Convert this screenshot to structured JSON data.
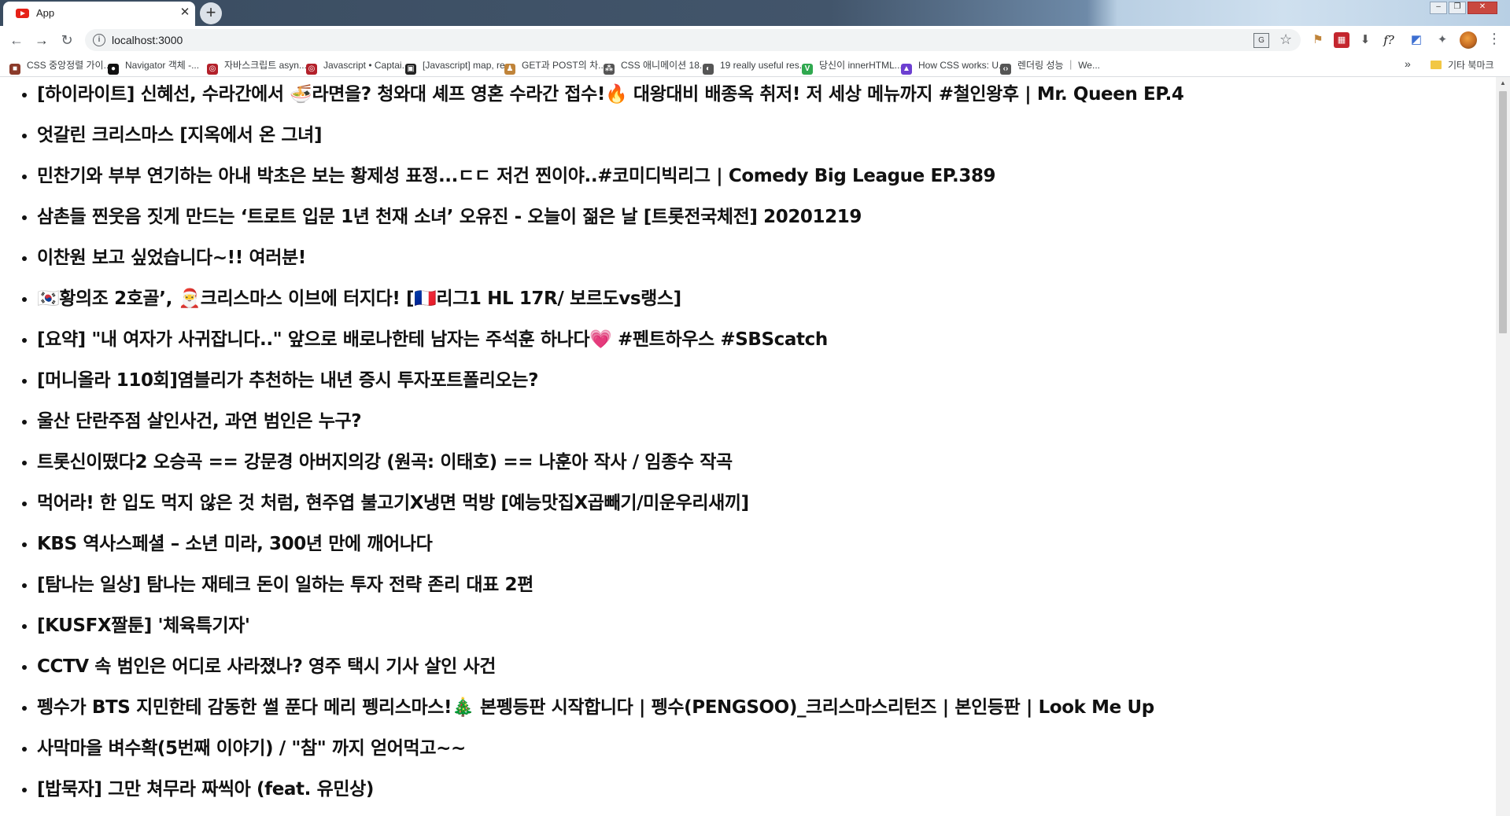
{
  "browser": {
    "tab": {
      "title": "App",
      "close": "✕"
    },
    "new_tab": "+",
    "window_controls": {
      "minimize": "–",
      "restore": "❐",
      "close": "✕"
    },
    "nav": {
      "back": "←",
      "forward": "→",
      "reload": "↻"
    },
    "address": {
      "url": "localhost:3000"
    },
    "menu_icon": "more-vert-icon"
  },
  "bookmarks": {
    "items": [
      {
        "label": "CSS 중앙정렬 가이...",
        "icon_color": "#8b3a2a",
        "icon": "■"
      },
      {
        "label": "Navigator 객체 -...",
        "icon_color": "#111111",
        "icon": "●"
      },
      {
        "label": "자바스크립트 asyn...",
        "icon_color": "#b3202a",
        "icon": "◎"
      },
      {
        "label": "Javascript • Captai...",
        "icon_color": "#b3202a",
        "icon": "◎"
      },
      {
        "label": "[Javascript] map, re...",
        "icon_color": "#222222",
        "icon": "▣"
      },
      {
        "label": "GET과 POST의 차...",
        "icon_color": "#c0843a",
        "icon": "♟"
      },
      {
        "label": "CSS 애니메이션 18...",
        "icon_color": "#555555",
        "icon": "⁂"
      },
      {
        "label": "19 really useful res...",
        "icon_color": "#555555",
        "icon": "◐"
      },
      {
        "label": "당신이 innerHTML...",
        "icon_color": "#2fa84f",
        "icon": "V"
      },
      {
        "label": "How CSS works: U...",
        "icon_color": "#6c3fd1",
        "icon": "▲"
      },
      {
        "label": "렌더링 성능 ｜ We...",
        "icon_color": "#555555",
        "icon": "‹›"
      }
    ],
    "more": "»",
    "other_folder": "기타 북마크"
  },
  "videos": [
    "[하이라이트] 신혜선, 수라간에서 🍜라면을? 청와대 셰프 영혼 수라간 접수!🔥 대왕대비 배종옥 취저! 저 세상 메뉴까지 #철인왕후 | Mr. Queen EP.4",
    "엇갈린 크리스마스 [지옥에서 온 그녀]",
    "민찬기와 부부 연기하는 아내 박초은 보는 황제성 표정...ㄷㄷ 저건 찐이야..#코미디빅리그 | Comedy Big League EP.389",
    "삼촌들 찐웃음 짓게 만드는 ‘트로트 입문 1년 천재 소녀’ 오유진 - 오늘이 젊은 날 [트롯전국체전] 20201219",
    "이찬원 보고 싶었습니다~!! 여러분!",
    "🇰🇷황의조 2호골’, 🎅크리스마스 이브에 터지다! [🇫🇷리그1 HL 17R/ 보르도vs랭스]",
    "[요약] \"내 여자가 사귀잡니다..\" 앞으로 배로나한테 남자는 주석훈 하나다💗 #펜트하우스 #SBScatch",
    "[머니올라 110회]염블리가 추천하는 내년 증시 투자포트폴리오는?",
    "울산 단란주점 살인사건, 과연 범인은 누구?",
    "트롯신이떴다2 오승곡 == 강문경 아버지의강 (원곡: 이태호) == 나훈아 작사 / 임종수 작곡",
    "먹어라! 한 입도 먹지 않은 것 처럼, 현주엽 불고기X냉면 먹방 [예능맛집X곱빼기/미운우리새끼]",
    "KBS 역사스페셜 – 소년 미라, 300년 만에 깨어나다",
    "[탐나는 일상] 탐나는 재테크 돈이 일하는 투자 전략 존리 대표 2편",
    "[KUSFX짤툰] '체육특기자'",
    "CCTV 속 범인은 어디로 사라졌나? 영주 택시 기사 살인 사건",
    "펭수가 BTS 지민한테 감동한 썰 푼다 메리 펭리스마스!🎄 본펭등판 시작합니다 | 펭수(PENGSOO)_크리스마스리턴즈 | 본인등판 | Look Me Up",
    "사막마을 벼수확(5번째 이야기) / \"참\" 까지 얻어먹고~~",
    "[밥묵자] 그만 쳐무라 짜씩아 (feat. 유민상)"
  ]
}
